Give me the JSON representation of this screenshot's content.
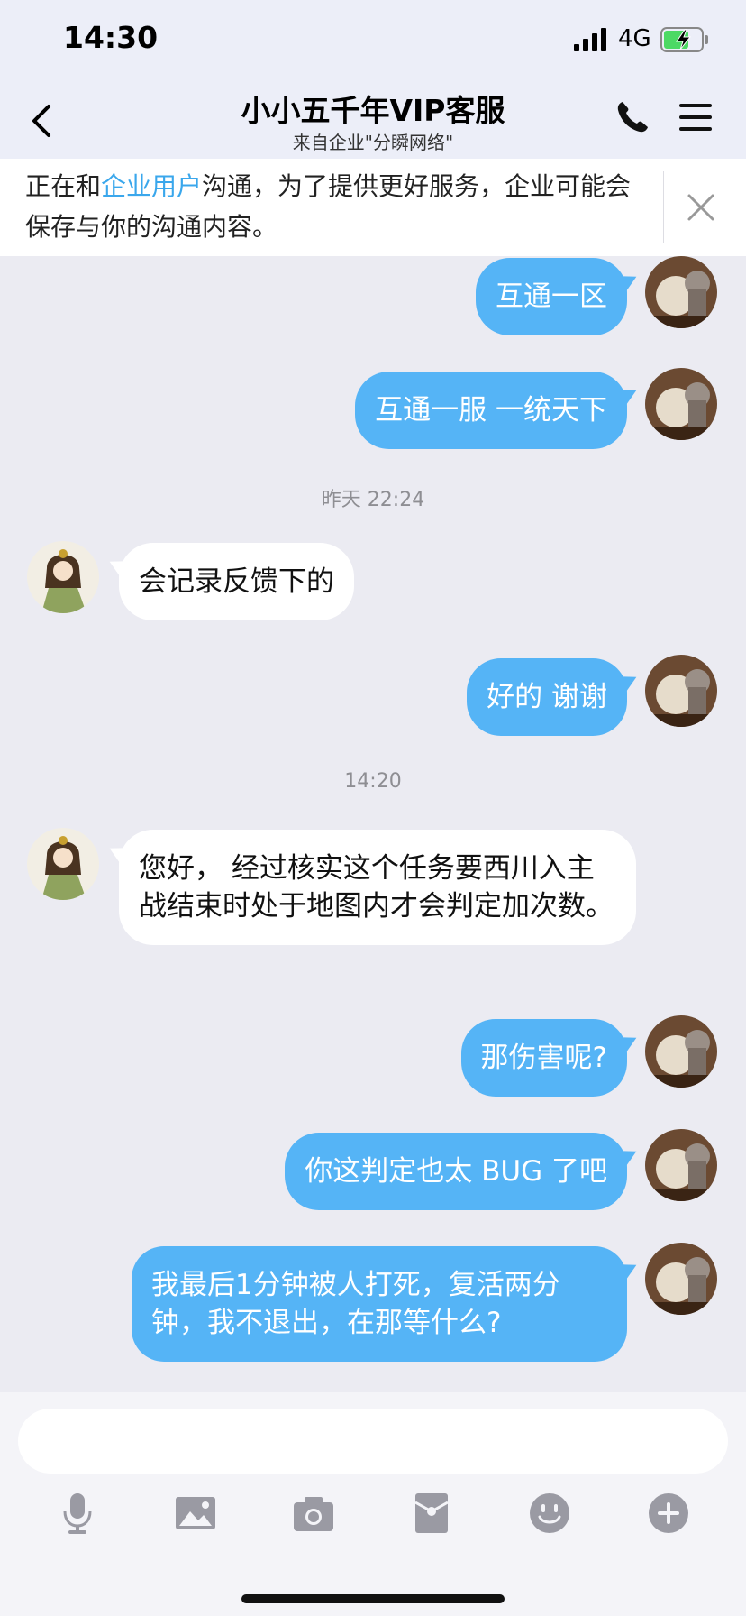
{
  "status": {
    "time": "14:30",
    "network": "4G",
    "battery_color": "#4cd964"
  },
  "nav": {
    "title": "小小五千年VIP客服",
    "subtitle": "来自企业\"分瞬网络\""
  },
  "notice": {
    "prefix": "正在和",
    "link": "企业用户",
    "suffix": "沟通，为了提供更好服务，企业可能会保存与你的沟通内容。"
  },
  "messages": [
    {
      "side": "right",
      "text": "互通一区"
    },
    {
      "side": "right",
      "text": "互通一服 一统天下"
    },
    {
      "type": "time",
      "text": "昨天 22:24"
    },
    {
      "side": "left",
      "text": "会记录反馈下的"
    },
    {
      "side": "right",
      "text": "好的 谢谢"
    },
    {
      "type": "time",
      "text": "14:20"
    },
    {
      "side": "left",
      "text": "您好， 经过核实这个任务要西川入主战结束时处于地图内才会判定加次数。"
    },
    {
      "side": "right",
      "text": "那伤害呢?"
    },
    {
      "side": "right",
      "text": "你这判定也太 BUG 了吧"
    },
    {
      "side": "right",
      "text": "我最后1分钟被人打死，复活两分钟，我不退出，在那等什么?"
    }
  ],
  "input": {
    "value": "",
    "placeholder": ""
  },
  "toolbar": [
    "microphone-icon",
    "image-icon",
    "camera-icon",
    "red-packet-icon",
    "emoji-icon",
    "plus-icon"
  ],
  "colors": {
    "bubble_out": "#55b4f6",
    "bubble_in": "#ffffff",
    "link": "#3aa7ec",
    "background": "#ebebf2"
  }
}
